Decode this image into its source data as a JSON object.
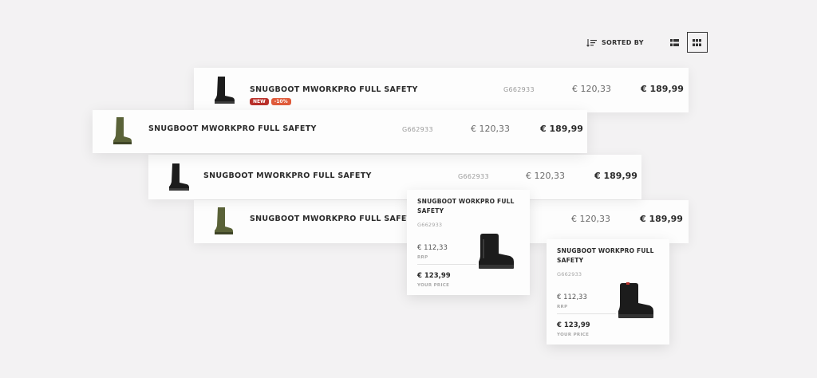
{
  "toolbar": {
    "sort_label": "SORTED BY",
    "sort_icon": "sort-icon",
    "views": [
      {
        "icon": "list-view-icon",
        "active": false
      },
      {
        "icon": "grid-view-icon",
        "active": true
      }
    ]
  },
  "rows": [
    {
      "name": "SNUGBOOT MWORKPRO FULL SAFETY",
      "sku": "G662933",
      "rrp": "€ 120,33",
      "price": "€ 189,99",
      "boot_color": "black",
      "badges": [
        "NEW",
        "-10%"
      ]
    },
    {
      "name": "SNUGBOOT MWORKPRO FULL SAFETY",
      "sku": "G662933",
      "rrp": "€ 120,33",
      "price": "€ 189,99",
      "boot_color": "olive",
      "badges": []
    },
    {
      "name": "SNUGBOOT MWORKPRO FULL SAFETY",
      "sku": "G662933",
      "rrp": "€ 120,33",
      "price": "€ 189,99",
      "boot_color": "black",
      "badges": []
    },
    {
      "name": "SNUGBOOT MWORKPRO FULL SAFETY",
      "sku": "",
      "rrp": "€ 120,33",
      "price": "€ 189,99",
      "boot_color": "olive",
      "badges": []
    }
  ],
  "cards": [
    {
      "name": "SNUGBOOT WORKPRO FULL SAFETY",
      "sku": "G662933",
      "rrp": "€ 112,33",
      "rrp_label": "RRP",
      "price": "€ 123,99",
      "price_label": "YOUR PRICE"
    },
    {
      "name": "SNUGBOOT WORKPRO FULL SAFETY",
      "sku": "G662933",
      "rrp": "€ 112,33",
      "rrp_label": "RRP",
      "price": "€ 123,99",
      "price_label": "YOUR PRICE"
    }
  ],
  "colors": {
    "background": "#f3f2f3",
    "badge_new": "#b9302a",
    "badge_discount": "#e05b3b",
    "boot_black": "#1c1c1c",
    "boot_olive": "#5a6238"
  }
}
